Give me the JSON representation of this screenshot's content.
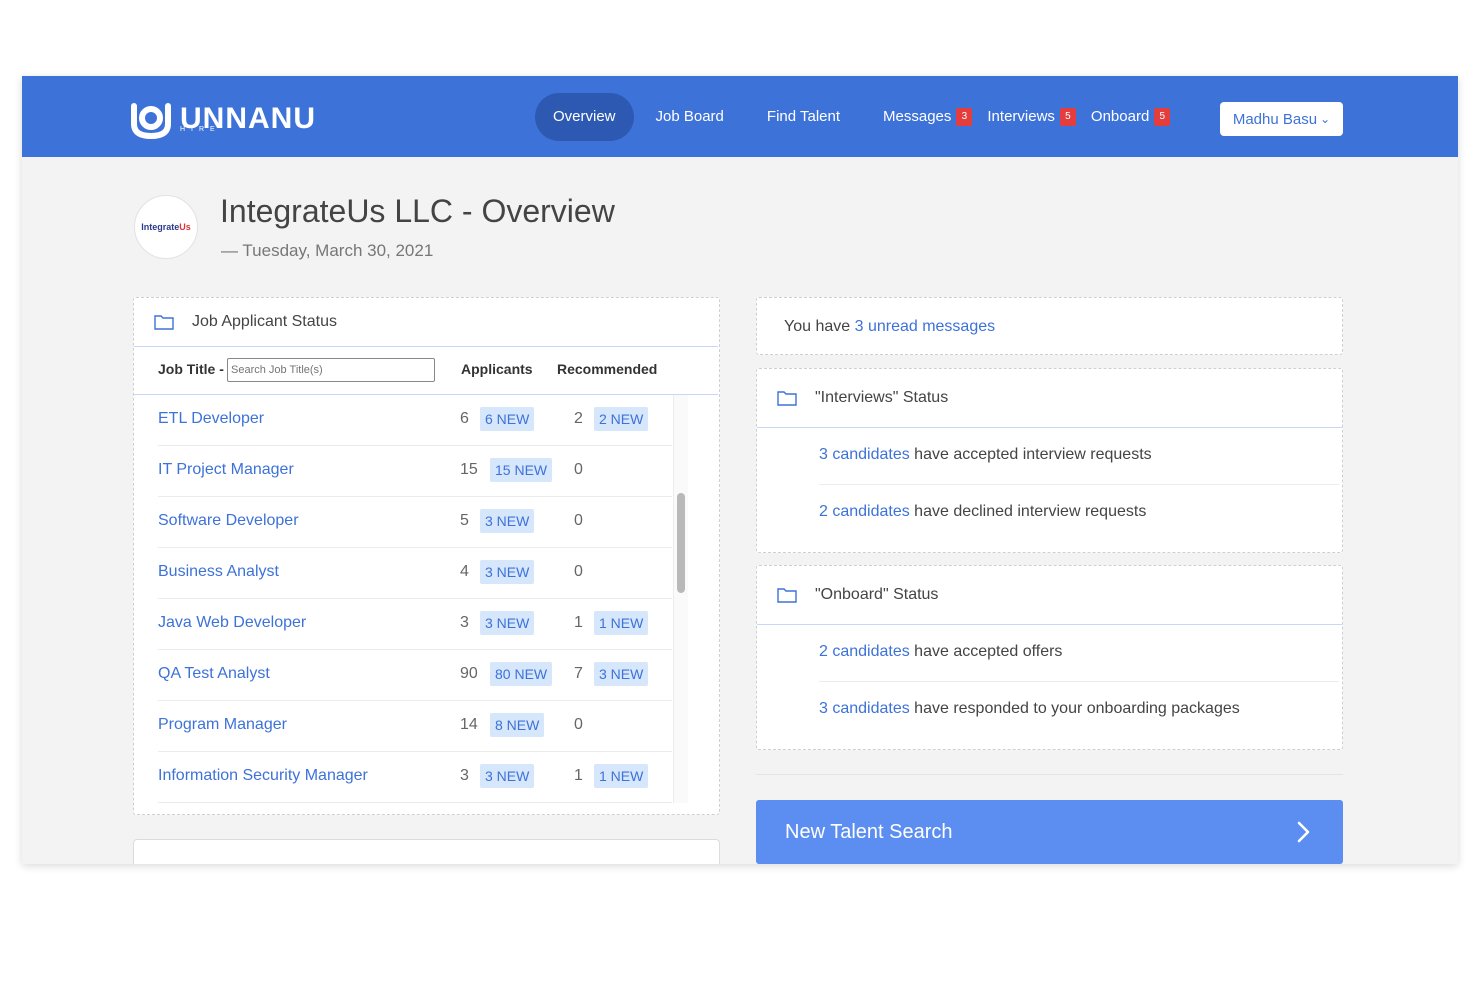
{
  "brand": {
    "name": "UNNANU",
    "sub": "HIRE"
  },
  "nav": [
    {
      "label": "Overview",
      "active": true
    },
    {
      "label": "Job Board"
    },
    {
      "label": "Find Talent"
    },
    {
      "label": "Messages",
      "badge": "3"
    },
    {
      "label": "Interviews",
      "badge": "5"
    },
    {
      "label": "Onboard",
      "badge": "5"
    }
  ],
  "user": {
    "name": "Madhu Basu",
    "chevron": "⌄"
  },
  "company": {
    "logo_text_a": "Integrate",
    "logo_text_b": "Us",
    "title": "IntegrateUs LLC - Overview",
    "date": "— Tuesday, March 30, 2021"
  },
  "applicant_status": {
    "title": "Job Applicant Status",
    "col_title": "Job Title -",
    "search_placeholder": "Search Job Title(s)",
    "col_applicants": "Applicants",
    "col_recommended": "Recommended",
    "rows": [
      {
        "title": "ETL Developer",
        "applicants": "6",
        "applicants_new": "6 NEW",
        "recommended": "2",
        "recommended_new": "2 NEW"
      },
      {
        "title": "IT Project Manager",
        "applicants": "15",
        "applicants_new": "15 NEW",
        "recommended": "0",
        "recommended_new": ""
      },
      {
        "title": "Software Developer",
        "applicants": "5",
        "applicants_new": "3 NEW",
        "recommended": "0",
        "recommended_new": ""
      },
      {
        "title": "Business Analyst",
        "applicants": "4",
        "applicants_new": "3 NEW",
        "recommended": "0",
        "recommended_new": ""
      },
      {
        "title": "Java Web Developer",
        "applicants": "3",
        "applicants_new": "3 NEW",
        "recommended": "1",
        "recommended_new": "1 NEW"
      },
      {
        "title": "QA Test Analyst",
        "applicants": "90",
        "applicants_new": "80 NEW",
        "recommended": "7",
        "recommended_new": "3 NEW"
      },
      {
        "title": "Program Manager",
        "applicants": "14",
        "applicants_new": "8 NEW",
        "recommended": "0",
        "recommended_new": ""
      },
      {
        "title": "Information Security Manager",
        "applicants": "3",
        "applicants_new": "3 NEW",
        "recommended": "1",
        "recommended_new": "1 NEW"
      }
    ]
  },
  "messages": {
    "prefix": "You have ",
    "link": "3 unread messages"
  },
  "interviews": {
    "title": "\"Interviews\" Status",
    "accepted_link": "3 candidates",
    "accepted_text": " have accepted interview requests",
    "declined_link": "2 candidates",
    "declined_text": " have declined interview requests"
  },
  "onboard": {
    "title": "\"Onboard\" Status",
    "offers_link": "2 candidates",
    "offers_text": " have accepted offers",
    "packages_link": "3 candidates",
    "packages_text": " have responded to your onboarding packages"
  },
  "cta": {
    "label": "New Talent Search"
  },
  "colors": {
    "primary": "#3d72d9",
    "nav_active": "#2d59b3",
    "badge": "#e33d3d",
    "cta": "#5b8ef0",
    "tag_bg": "#d6e6fb"
  }
}
